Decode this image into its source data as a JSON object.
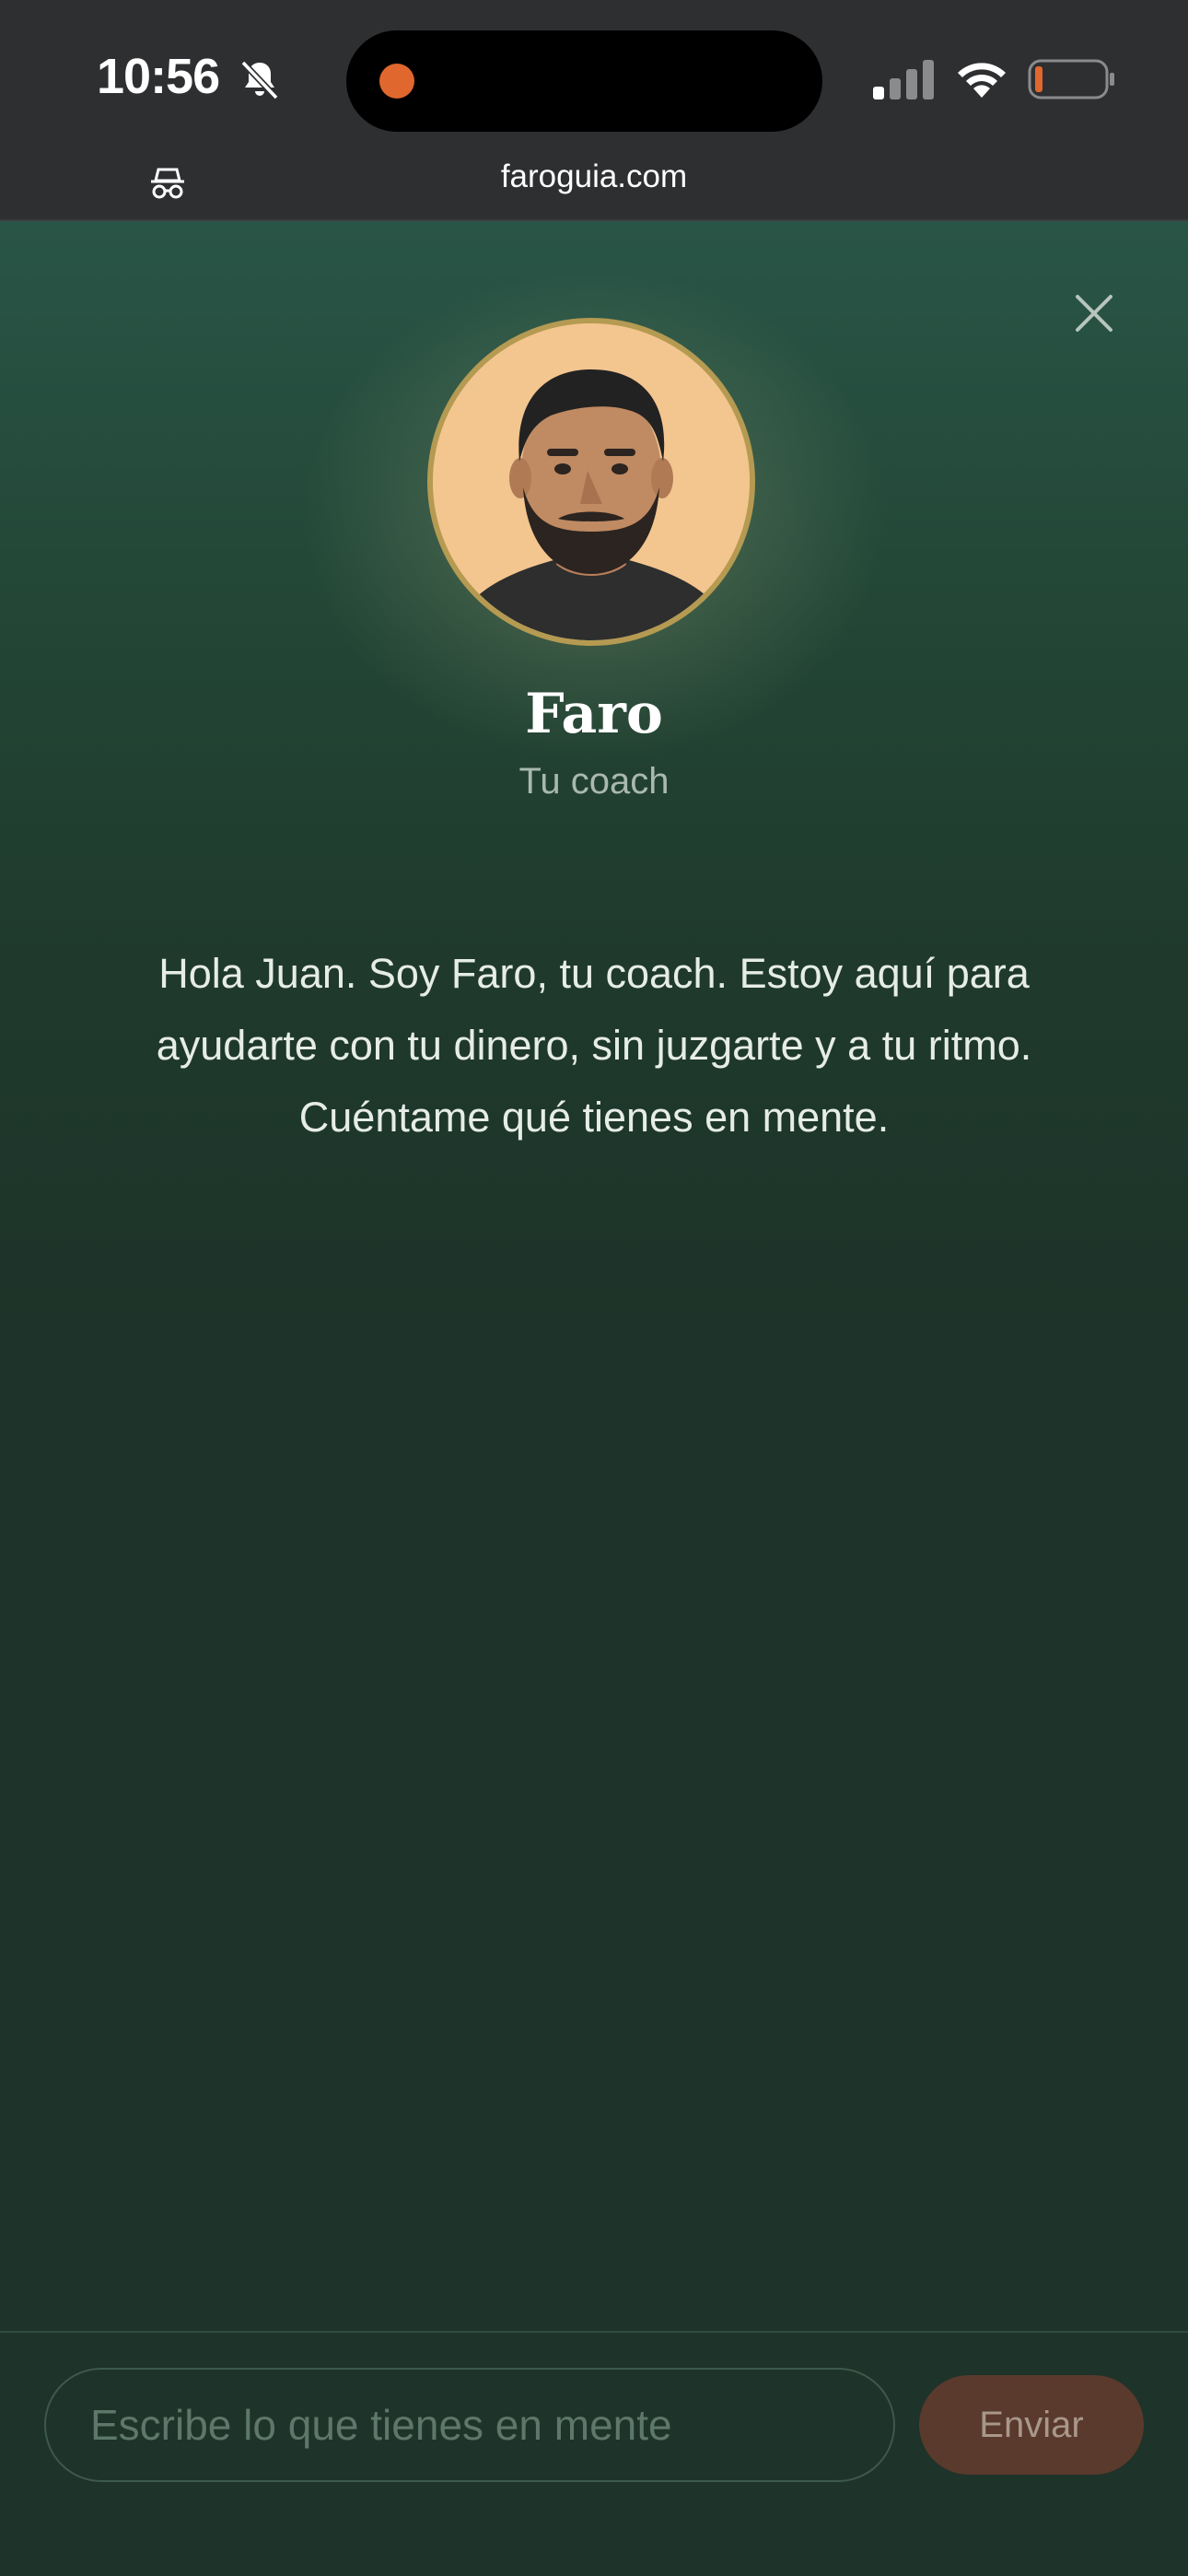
{
  "status_bar": {
    "time": "10:56",
    "icons": [
      "bell-off-icon",
      "signal-icon",
      "wifi-icon",
      "battery-icon"
    ],
    "recording_indicator_color": "#e0672e",
    "battery_level_color": "#e0672e"
  },
  "browser": {
    "url": "faroguia.com",
    "mode_icon": "incognito-icon"
  },
  "coach": {
    "name": "Faro",
    "role": "Tu coach",
    "avatar_border_color": "#b59a52"
  },
  "chat": {
    "greeting": "Hola Juan. Soy Faro, tu coach. Estoy aquí para ayudarte con tu dinero, sin juzgarte y a tu ritmo. Cuéntame qué tienes en mente."
  },
  "composer": {
    "placeholder": "Escribe lo que tienes en mente",
    "value": "",
    "send_label": "Enviar"
  },
  "colors": {
    "background": "#1e3329",
    "accent_button": "#5a3a2c",
    "text_primary": "#ffffff",
    "text_muted": "#a9b8b0"
  }
}
